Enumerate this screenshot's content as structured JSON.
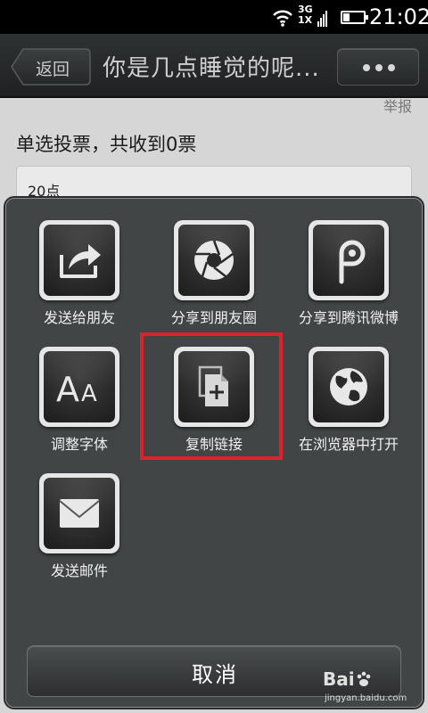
{
  "status_bar": {
    "network_top": "3G",
    "network_bottom": "1X",
    "time": "21:02",
    "battery_level": 0.3
  },
  "title_bar": {
    "back_label": "返回",
    "title": "你是几点睡觉的呢...",
    "more_icon": "ellipsis-icon"
  },
  "content": {
    "cut_text": "举报",
    "vote_title": "单选投票，共收到0票",
    "option_1": "20点"
  },
  "share_sheet": {
    "items": [
      {
        "label": "发送给朋友",
        "icon": "share-arrow-icon"
      },
      {
        "label": "分享到朋友圈",
        "icon": "camera-aperture-icon"
      },
      {
        "label": "分享到腾讯微博",
        "icon": "tencent-weibo-icon"
      },
      {
        "label": "调整字体",
        "icon": "font-size-icon"
      },
      {
        "label": "复制链接",
        "icon": "copy-link-icon"
      },
      {
        "label": "在浏览器中打开",
        "icon": "globe-icon"
      },
      {
        "label": "发送邮件",
        "icon": "envelope-icon"
      }
    ],
    "cancel_label": "取消",
    "highlight_color": "#d9232e"
  },
  "watermark": {
    "logo": "Bai",
    "sub": "jingyan.baidu.com"
  }
}
